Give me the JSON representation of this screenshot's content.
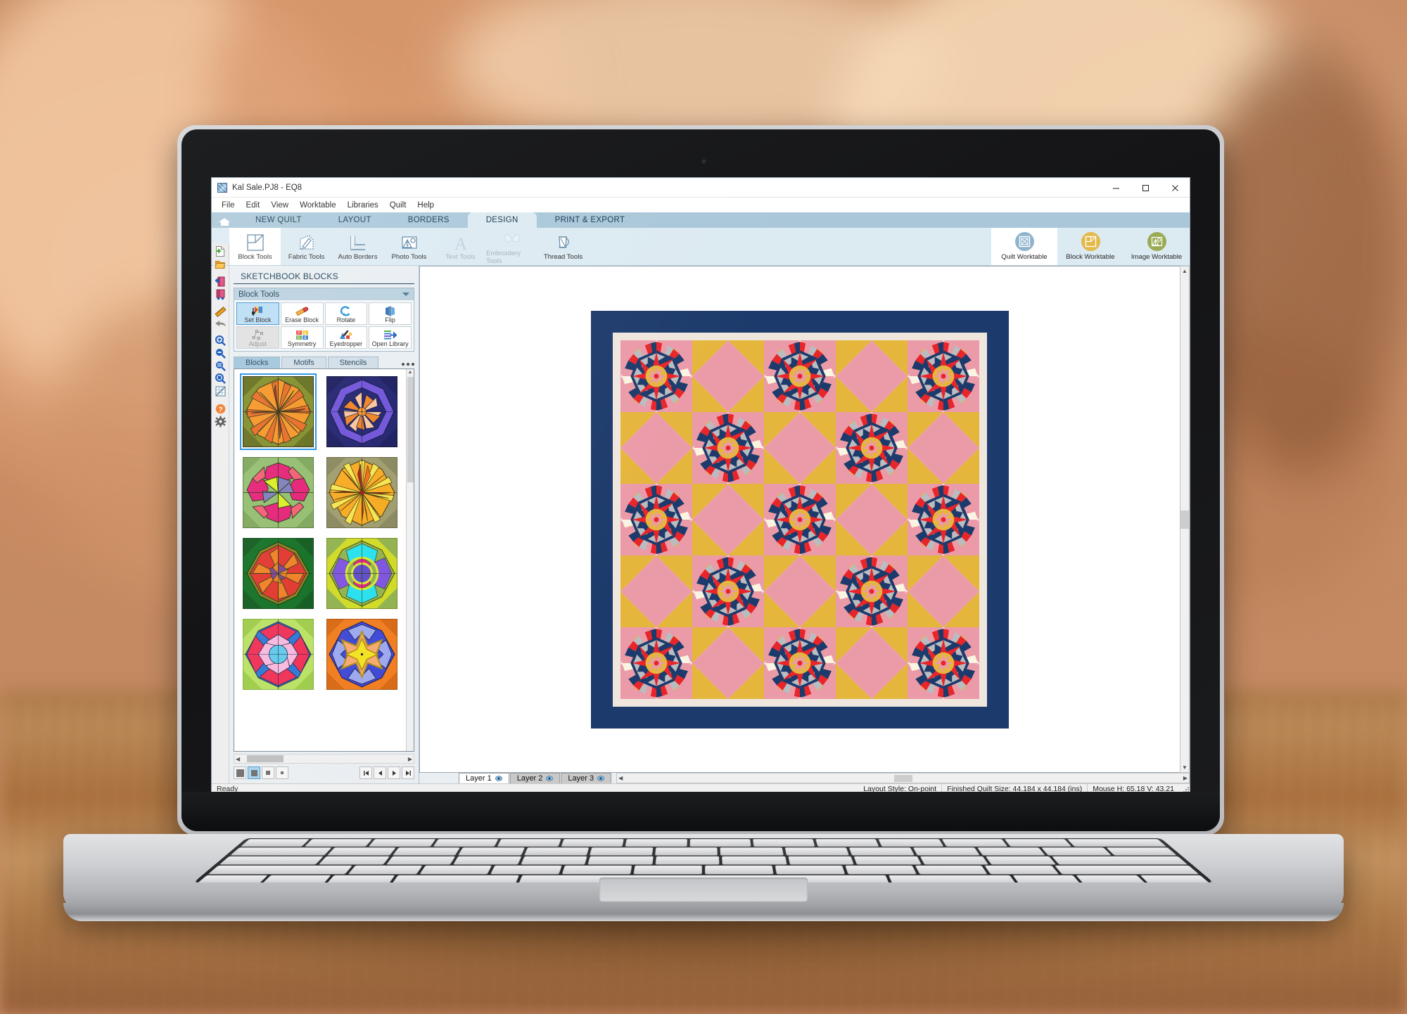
{
  "window": {
    "title": "Kal Sale.PJ8 - EQ8",
    "icon": "eq8-app-icon",
    "controls": {
      "minimize": "—",
      "maximize": "☐",
      "close": "✕"
    }
  },
  "menubar": {
    "items": [
      "File",
      "Edit",
      "View",
      "Worktable",
      "Libraries",
      "Quilt",
      "Help"
    ]
  },
  "ribbon": {
    "home_icon": "home-icon",
    "tabs": [
      {
        "label": "NEW QUILT",
        "active": false
      },
      {
        "label": "LAYOUT",
        "active": false
      },
      {
        "label": "BORDERS",
        "active": false
      },
      {
        "label": "DESIGN",
        "active": true
      },
      {
        "label": "PRINT & EXPORT",
        "active": false
      }
    ],
    "buttons": [
      {
        "label": "Block Tools",
        "icon": "block-tools-icon",
        "active": true,
        "disabled": false
      },
      {
        "label": "Fabric Tools",
        "icon": "fabric-tools-icon",
        "active": false,
        "disabled": false
      },
      {
        "label": "Auto Borders",
        "icon": "auto-borders-icon",
        "active": false,
        "disabled": false
      },
      {
        "label": "Photo Tools",
        "icon": "photo-tools-icon",
        "active": false,
        "disabled": false
      },
      {
        "label": "Text Tools",
        "icon": "text-tools-icon",
        "active": false,
        "disabled": true
      },
      {
        "label": "Embroidery Tools",
        "icon": "embroidery-tools-icon",
        "active": false,
        "disabled": true
      },
      {
        "label": "Thread Tools",
        "icon": "thread-tools-icon",
        "active": false,
        "disabled": false
      }
    ],
    "worktables": [
      {
        "label": "Quilt Worktable",
        "icon": "quilt-worktable-icon",
        "color": "#8fb4cb",
        "active": true
      },
      {
        "label": "Block Worktable",
        "icon": "block-worktable-icon",
        "color": "#e3b949",
        "active": false
      },
      {
        "label": "Image Worktable",
        "icon": "image-worktable-icon",
        "color": "#9aab55",
        "active": false
      }
    ]
  },
  "left_toolbar": {
    "items": [
      {
        "name": "new-file-icon"
      },
      {
        "name": "open-file-icon"
      },
      {
        "name": "add-to-sketchbook-icon"
      },
      {
        "name": "view-sketchbook-icon"
      },
      {
        "name": "ruler-icon"
      },
      {
        "name": "undo-icon"
      },
      {
        "name": "zoom-in-icon"
      },
      {
        "name": "zoom-out-icon"
      },
      {
        "name": "zoom-previous-icon"
      },
      {
        "name": "zoom-fit-icon"
      },
      {
        "name": "grid-icon"
      },
      {
        "name": "help-icon"
      },
      {
        "name": "settings-icon"
      }
    ]
  },
  "panel": {
    "title": "SKETCHBOOK BLOCKS",
    "tools_header": "Block Tools",
    "tools": [
      {
        "label": "Set Block",
        "icon": "set-block-icon",
        "selected": true,
        "disabled": false
      },
      {
        "label": "Erase Block",
        "icon": "erase-block-icon",
        "selected": false,
        "disabled": false
      },
      {
        "label": "Rotate",
        "icon": "rotate-icon",
        "selected": false,
        "disabled": false
      },
      {
        "label": "Flip",
        "icon": "flip-icon",
        "selected": false,
        "disabled": false
      },
      {
        "label": "Adjust",
        "icon": "adjust-icon",
        "selected": false,
        "disabled": true
      },
      {
        "label": "Symmetry",
        "icon": "symmetry-icon",
        "selected": false,
        "disabled": false
      },
      {
        "label": "Eyedropper",
        "icon": "eyedropper-icon",
        "selected": false,
        "disabled": false
      },
      {
        "label": "Open Library",
        "icon": "open-library-icon",
        "selected": false,
        "disabled": false
      }
    ],
    "tabs": [
      {
        "label": "Blocks",
        "active": true
      },
      {
        "label": "Motifs",
        "active": false
      },
      {
        "label": "Stencils",
        "active": false
      }
    ],
    "overflow_menu": "more-options-icon",
    "thumbnails": [
      {
        "name": "block-thumb-1",
        "description": "orange olive kaleidoscope",
        "selected": true,
        "bg": "#7d8a22",
        "corner": "#5f6b17",
        "petal": "#f5921e",
        "accent": "#b92318",
        "accent2": "#e8671c",
        "center": "#f5a623"
      },
      {
        "name": "block-thumb-2",
        "description": "navy purple peach kaleidoscope",
        "selected": false,
        "bg": "#1b1d6b",
        "corner": "#141659",
        "petal": "#6b4fd8",
        "accent": "#f7c49a",
        "accent2": "#ef7f1f",
        "center": "#f79520"
      },
      {
        "name": "block-thumb-3",
        "description": "green magenta lime kaleidoscope",
        "selected": false,
        "bg": "#8fbb6a",
        "corner": "#7aa457",
        "petal": "#e51a72",
        "accent": "#d9ee1c",
        "accent2": "#f25a6e",
        "center": "#7a7ab8"
      },
      {
        "name": "block-thumb-4",
        "description": "olive yellow orange red kaleidoscope",
        "selected": false,
        "bg": "#9c9a6a",
        "corner": "#86855a",
        "petal": "#f7a81b",
        "accent": "#b51212",
        "accent2": "#f56a12",
        "center": "#f5e34a"
      },
      {
        "name": "block-thumb-5",
        "description": "dark green red orange kaleidoscope",
        "selected": false,
        "bg": "#0c6b1e",
        "corner": "#0a5618",
        "petal": "#e03026",
        "accent": "#8c7a14",
        "accent2": "#ef7c1c",
        "center": "#7b3f8c"
      },
      {
        "name": "block-thumb-6",
        "description": "lime cyan magenta purple kaleidoscope",
        "selected": false,
        "bg": "#cfd920",
        "corner": "#8fb04a",
        "petal": "#22e0ee",
        "accent": "#ed1a8b",
        "accent2": "#7b4fe0",
        "center": "#5b49c9"
      },
      {
        "name": "block-thumb-7",
        "description": "lime blue pink kaleidoscope",
        "selected": false,
        "bg": "#b8e060",
        "corner": "#9ccb45",
        "petal": "#2a73d4",
        "accent": "#ef2b52",
        "accent2": "#f8b7dd",
        "center": "#5ec8ea"
      },
      {
        "name": "block-thumb-8",
        "description": "orange blue yellow star kaleidoscope",
        "selected": false,
        "bg": "#f07a1a",
        "corner": "#d6660f",
        "petal": "#3a45d4",
        "accent": "#9aa6ee",
        "accent2": "#f1e11c",
        "center": "#f5ef3a"
      }
    ],
    "size_buttons": [
      {
        "name": "thumb-size-large",
        "selected": false
      },
      {
        "name": "thumb-size-medium",
        "selected": true
      },
      {
        "name": "thumb-size-small",
        "selected": false
      },
      {
        "name": "thumb-size-tiny",
        "selected": false
      }
    ],
    "nav_buttons": [
      {
        "name": "nav-first",
        "glyph": "⏮"
      },
      {
        "name": "nav-prev",
        "glyph": "◀"
      },
      {
        "name": "nav-next",
        "glyph": "▶"
      },
      {
        "name": "nav-last",
        "glyph": "⏭"
      }
    ]
  },
  "worktable": {
    "layers": [
      {
        "label": "Layer 1",
        "active": true,
        "icon": "eye-icon"
      },
      {
        "label": "Layer 2",
        "active": false,
        "icon": "eye-icon"
      },
      {
        "label": "Layer 3",
        "active": false,
        "icon": "eye-icon"
      }
    ],
    "quilt": {
      "name": "kaleidoscope-quilt",
      "outer_border_color": "#1c3a6b",
      "inner_border_color": "#efe6de",
      "background_color": "#faf5ea",
      "grid": {
        "rows": 5,
        "cols": 5
      },
      "palette": {
        "navy": "#1c3a6b",
        "red": "#e8252b",
        "pink": "#eb9aa8",
        "cream": "#fbf4e2",
        "gold": "#e5b63c",
        "gray": "#b9bcc0",
        "darkgold": "#c59a3a"
      }
    }
  },
  "statusbar": {
    "ready": "Ready",
    "layout_style": "Layout Style: On-point",
    "quilt_size": "Finished Quilt Size: 44.184 x 44.184 (ins)",
    "mouse": "Mouse   H:  65.18    V:  43.21"
  }
}
